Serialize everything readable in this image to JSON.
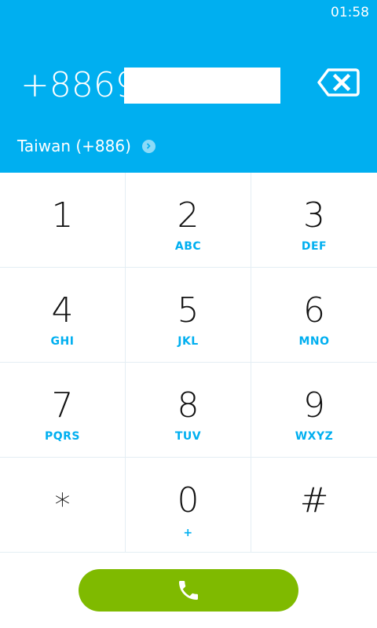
{
  "status_bar": {
    "time": "01:58"
  },
  "dialer": {
    "number": "+8869",
    "country": "Taiwan (+886)"
  },
  "keypad": [
    {
      "digit": "1",
      "letters": ""
    },
    {
      "digit": "2",
      "letters": "ABC"
    },
    {
      "digit": "3",
      "letters": "DEF"
    },
    {
      "digit": "4",
      "letters": "GHI"
    },
    {
      "digit": "5",
      "letters": "JKL"
    },
    {
      "digit": "6",
      "letters": "MNO"
    },
    {
      "digit": "7",
      "letters": "PQRS"
    },
    {
      "digit": "8",
      "letters": "TUV"
    },
    {
      "digit": "9",
      "letters": "WXYZ"
    },
    {
      "digit": "*",
      "letters": ""
    },
    {
      "digit": "0",
      "letters": "+"
    },
    {
      "digit": "#",
      "letters": ""
    }
  ],
  "icons": {
    "backspace": "backspace-icon",
    "country_chevron": "chevron-right-icon",
    "call": "phone-icon"
  },
  "colors": {
    "accent": "#00aff0",
    "call": "#7fba00",
    "digit": "#111111"
  }
}
